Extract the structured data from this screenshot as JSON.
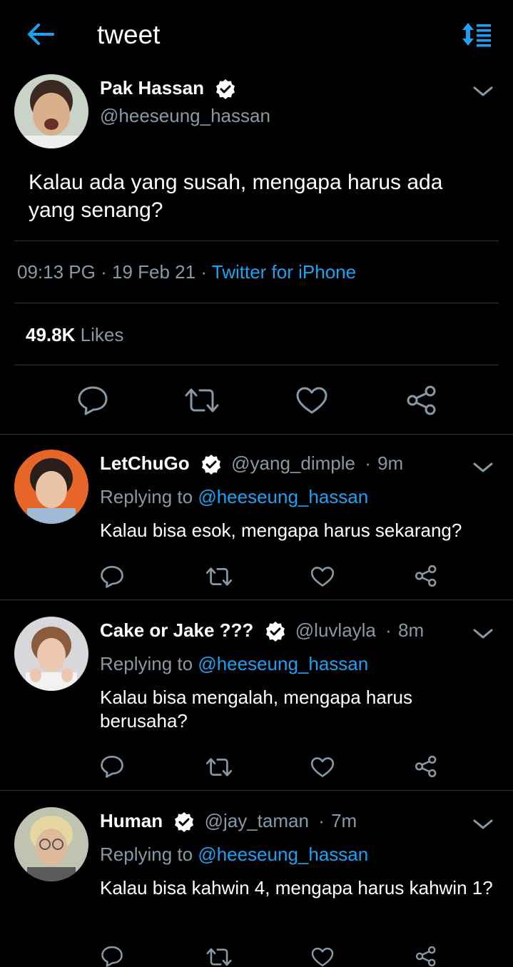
{
  "header": {
    "title": "tweet",
    "back_icon": "arrow-left-icon",
    "sort_icon": "sort-list-icon",
    "accent": "#1da1f2"
  },
  "main_tweet": {
    "name": "Pak Hassan",
    "handle": "@heeseung_hassan",
    "verified": true,
    "text": "Kalau ada yang susah, mengapa harus ada yang senang?",
    "time": "09:13 PG",
    "separator": "·",
    "date": "19 Feb 21",
    "source": "Twitter for iPhone",
    "likes_count": "49.8K",
    "likes_label": "Likes",
    "actions": [
      "reply-icon",
      "retweet-icon",
      "like-icon",
      "share-icon"
    ]
  },
  "replies": [
    {
      "name": "LetChuGo",
      "handle": "@yang_dimple",
      "time": "9m",
      "separator": "·",
      "replying_label": "Replying to",
      "replying_to": "@heeseung_hassan",
      "text": "Kalau bisa esok, mengapa harus sekarang?"
    },
    {
      "name": "Cake or Jake ???",
      "handle": "@luvlayla",
      "time": "8m",
      "separator": "·",
      "replying_label": "Replying to",
      "replying_to": "@heeseung_hassan",
      "text": "Kalau bisa mengalah, mengapa harus berusaha?"
    },
    {
      "name": "Human",
      "handle": "@jay_taman",
      "time": "7m",
      "separator": "·",
      "replying_label": "Replying to",
      "replying_to": "@heeseung_hassan",
      "text": "Kalau bisa kahwin 4, mengapa harus kahwin 1?"
    }
  ],
  "colors": {
    "background": "#000000",
    "text_primary": "#ffffff",
    "text_secondary": "#8899a6",
    "link": "#1da1f2",
    "divider": "#2f3336"
  }
}
